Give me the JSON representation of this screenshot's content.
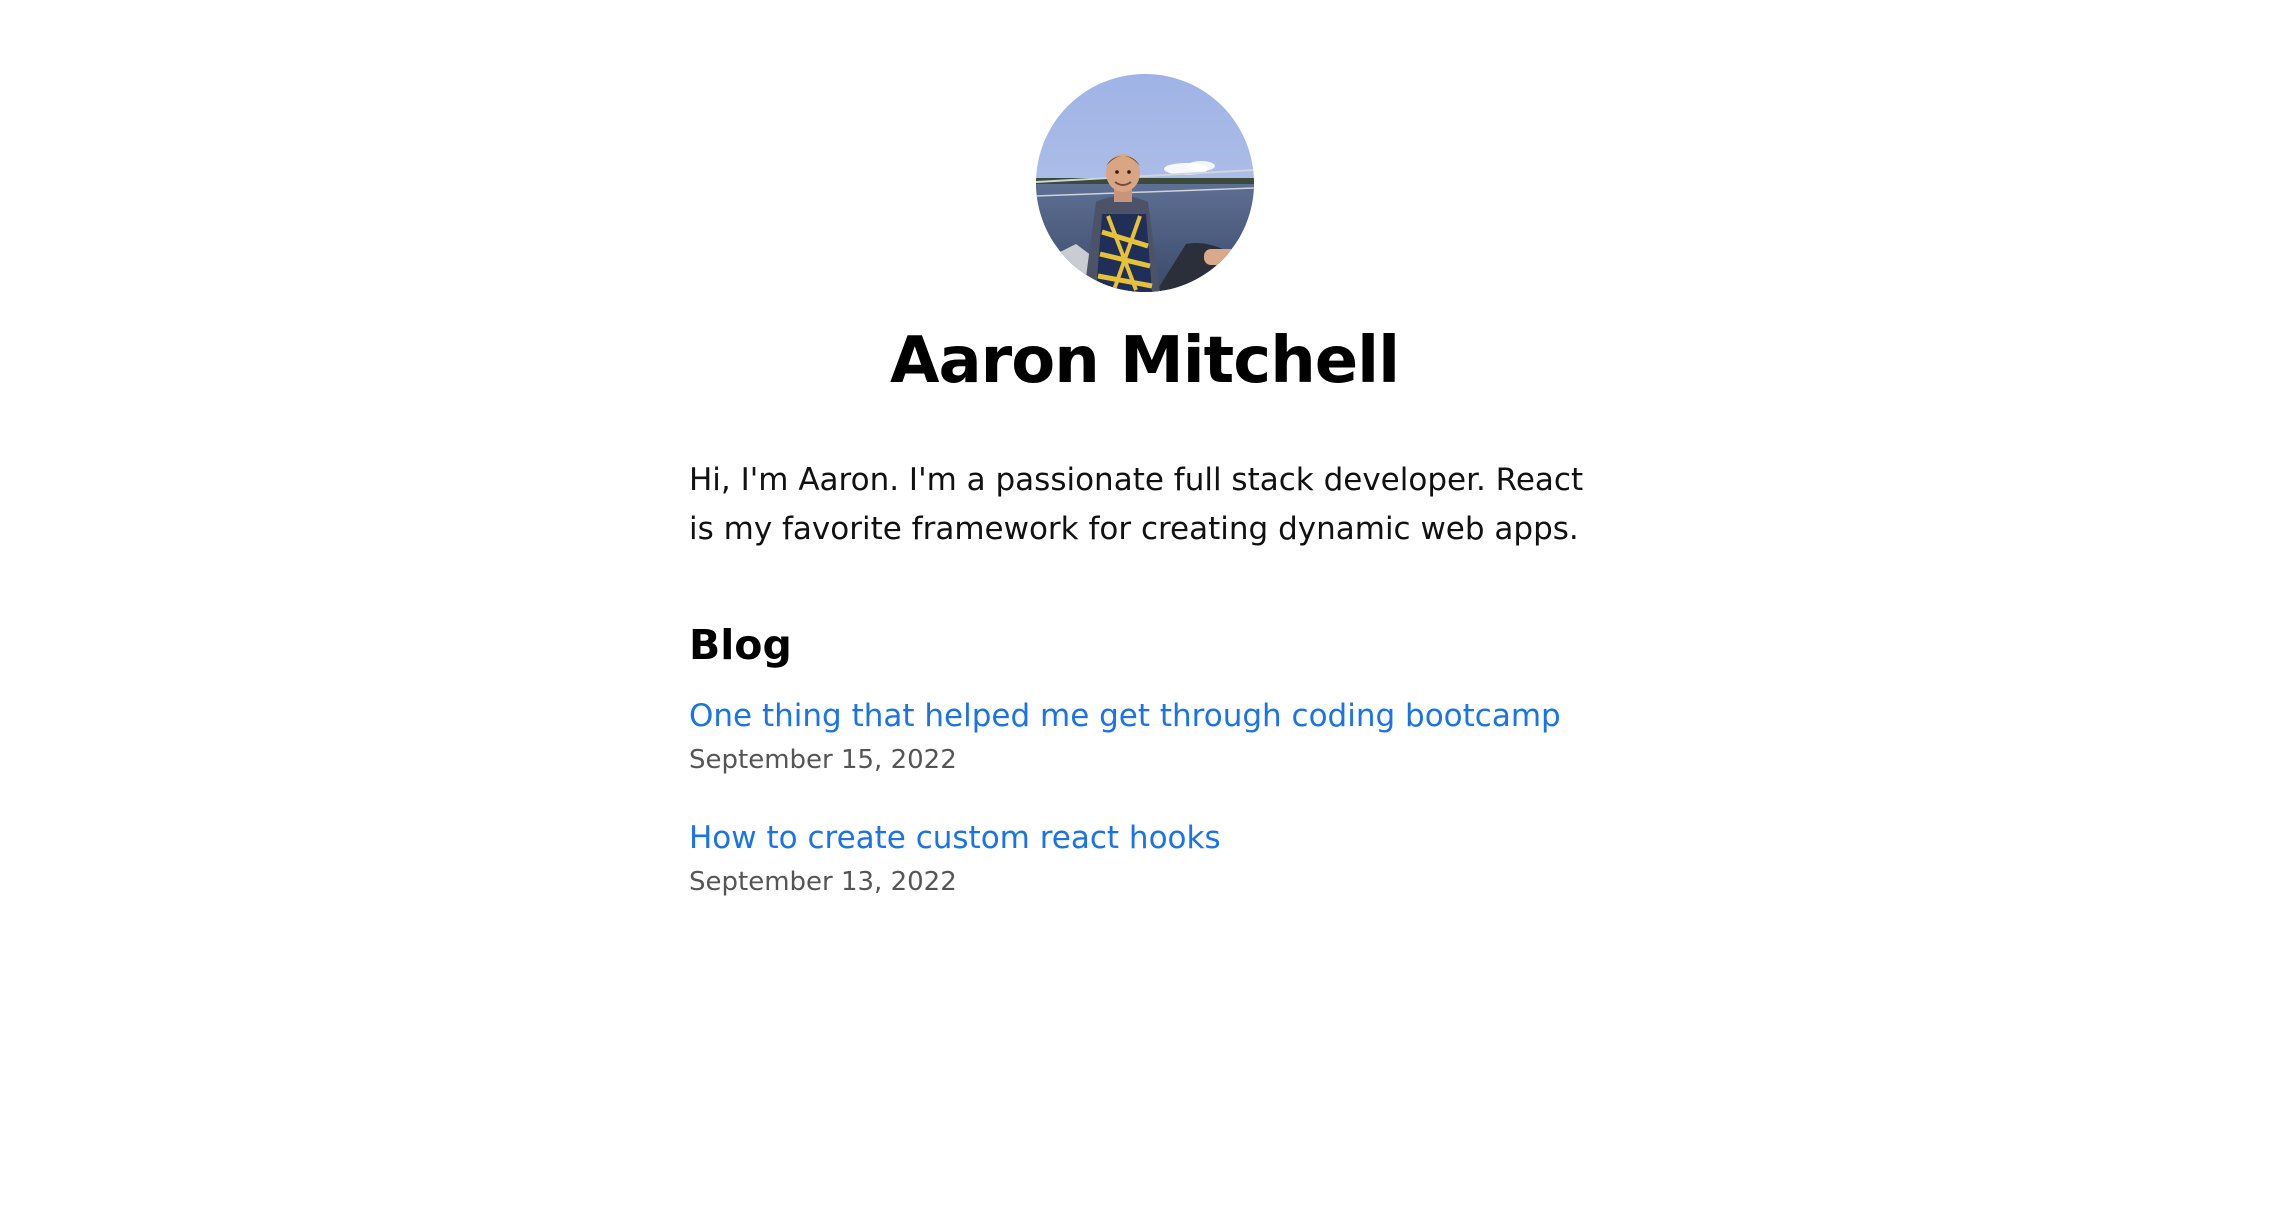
{
  "profile": {
    "name": "Aaron Mitchell",
    "intro": "Hi, I'm Aaron. I'm a passionate full stack developer. React is my favorite framework for creating dynamic web apps."
  },
  "blog": {
    "heading": "Blog",
    "posts": [
      {
        "title": "One thing that helped me get through coding bootcamp",
        "date": "September 15, 2022"
      },
      {
        "title": "How to create custom react hooks",
        "date": "September 13, 2022"
      }
    ]
  },
  "colors": {
    "link": "#1a73e8",
    "date": "#555555",
    "text": "#111111"
  }
}
